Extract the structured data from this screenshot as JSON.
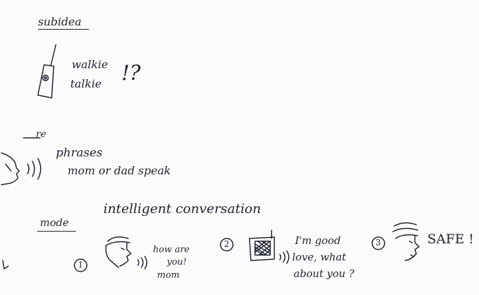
{
  "title": "subidea",
  "walkie": {
    "line1": "walkie",
    "line2": "talkie",
    "mark": "!?"
  },
  "re": "re",
  "phrases": {
    "line1": "phrases",
    "line2": "mom or dad speak"
  },
  "mode": {
    "label": "mode",
    "heading": "intelligent conversation"
  },
  "steps": [
    {
      "num": "1",
      "line1": "how are",
      "line2": "you!",
      "line3": "mom"
    },
    {
      "num": "2",
      "line1": "I'm good",
      "line2": "love, what",
      "line3": "about you ?"
    },
    {
      "num": "3",
      "line1": "SAFE !"
    }
  ],
  "icons": [
    "walkie-talkie-icon",
    "speaking-face-icon",
    "sound-waves-icon",
    "radio-device-icon"
  ]
}
